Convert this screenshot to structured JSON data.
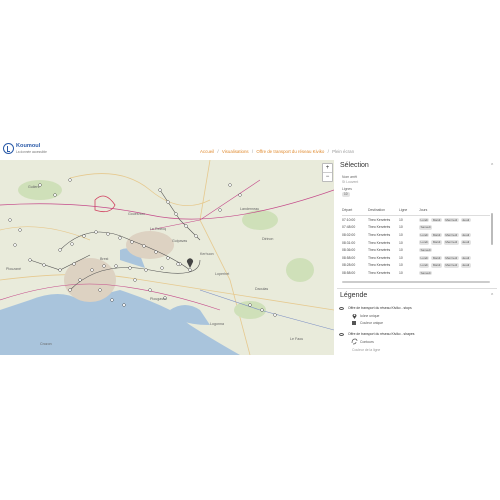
{
  "header": {
    "logo_name": "Koumoul",
    "logo_tagline": "La donnée accessible",
    "breadcrumb": [
      {
        "label": "Accueil",
        "type": "link"
      },
      {
        "label": "/",
        "type": "sep"
      },
      {
        "label": "Visualisations",
        "type": "link"
      },
      {
        "label": "/",
        "type": "sep"
      },
      {
        "label": "Offre de transport du réseau Kiviko",
        "type": "link"
      },
      {
        "label": "/",
        "type": "sep"
      },
      {
        "label": "Plein écran",
        "type": "current"
      }
    ]
  },
  "map": {
    "zoom_in": "+",
    "zoom_out": "−",
    "places": [
      "Guilers",
      "Brest",
      "Plouzané",
      "Gouesnou",
      "Guipavas",
      "Le Relecq",
      "Plougastel",
      "Kerhuon",
      "Landerneau",
      "Dirinon",
      "Loperhet",
      "Daoulas",
      "Logonna",
      "Crozon",
      "Le Faou"
    ]
  },
  "selection": {
    "title": "Sélection",
    "stop_label": "Nom arrêt",
    "stop_value": "St Louvent",
    "line_label": "Lignes",
    "line_value": "10",
    "columns": [
      "Départ",
      "Destination",
      "Ligne",
      "Jours"
    ],
    "rows": [
      {
        "time": "07:10:00",
        "dest": "Theo Kerzérès",
        "line": "10",
        "days": [
          "Lundi",
          "Mardi",
          "Mercredi",
          "Jeudi"
        ]
      },
      {
        "time": "07:48:00",
        "dest": "Theo Kerzérès",
        "line": "10",
        "days": [
          "Samedi"
        ]
      },
      {
        "time": "08:02:00",
        "dest": "Theo Kerzérès",
        "line": "10",
        "days": [
          "Lundi",
          "Mardi",
          "Mercredi",
          "Jeudi"
        ]
      },
      {
        "time": "08:31:00",
        "dest": "Theo Kerzérès",
        "line": "10",
        "days": [
          "Lundi",
          "Mardi",
          "Mercredi",
          "Jeudi"
        ]
      },
      {
        "time": "08:36:00",
        "dest": "Theo Kerzérès",
        "line": "10",
        "days": [
          "Samedi"
        ]
      },
      {
        "time": "08:58:00",
        "dest": "Theo Kerzérès",
        "line": "10",
        "days": [
          "Lundi",
          "Mardi",
          "Mercredi",
          "Jeudi"
        ]
      },
      {
        "time": "08:28:00",
        "dest": "Theo Kerzérès",
        "line": "10",
        "days": [
          "Lundi",
          "Mardi",
          "Mercredi",
          "Jeudi"
        ]
      },
      {
        "time": "08:58:00",
        "dest": "Theo Kerzérès",
        "line": "10",
        "days": [
          "Samedi"
        ]
      }
    ]
  },
  "legend": {
    "title": "Légende",
    "group1_title": "Offre de transport du réseau Kiviko - stops",
    "group1_items": [
      "Icône unique",
      "Couleur unique"
    ],
    "group2_title": "Offre de transport du réseau Kiviko - shapes",
    "group2_items": [
      "Contours"
    ],
    "group2_note": "Couleur de la ligne"
  }
}
